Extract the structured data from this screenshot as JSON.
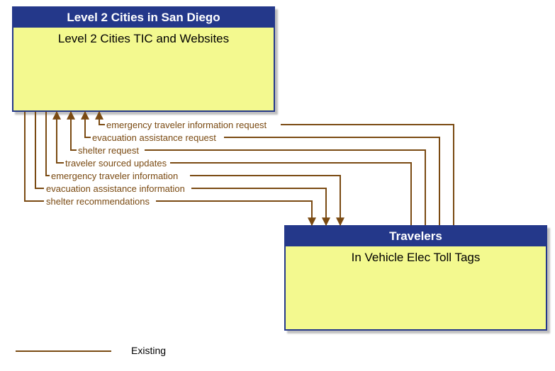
{
  "boxes": {
    "top": {
      "header": "Level 2 Cities in San Diego",
      "body": "Level 2 Cities TIC and Websites"
    },
    "bottom": {
      "header": "Travelers",
      "body": "In Vehicle Elec Toll Tags"
    }
  },
  "flows": {
    "f1": "emergency traveler information request",
    "f2": "evacuation assistance request",
    "f3": "shelter request",
    "f4": "traveler sourced updates",
    "f5": "emergency traveler information",
    "f6": "evacuation assistance information",
    "f7": "shelter recommendations"
  },
  "legend": {
    "existing": "Existing"
  }
}
